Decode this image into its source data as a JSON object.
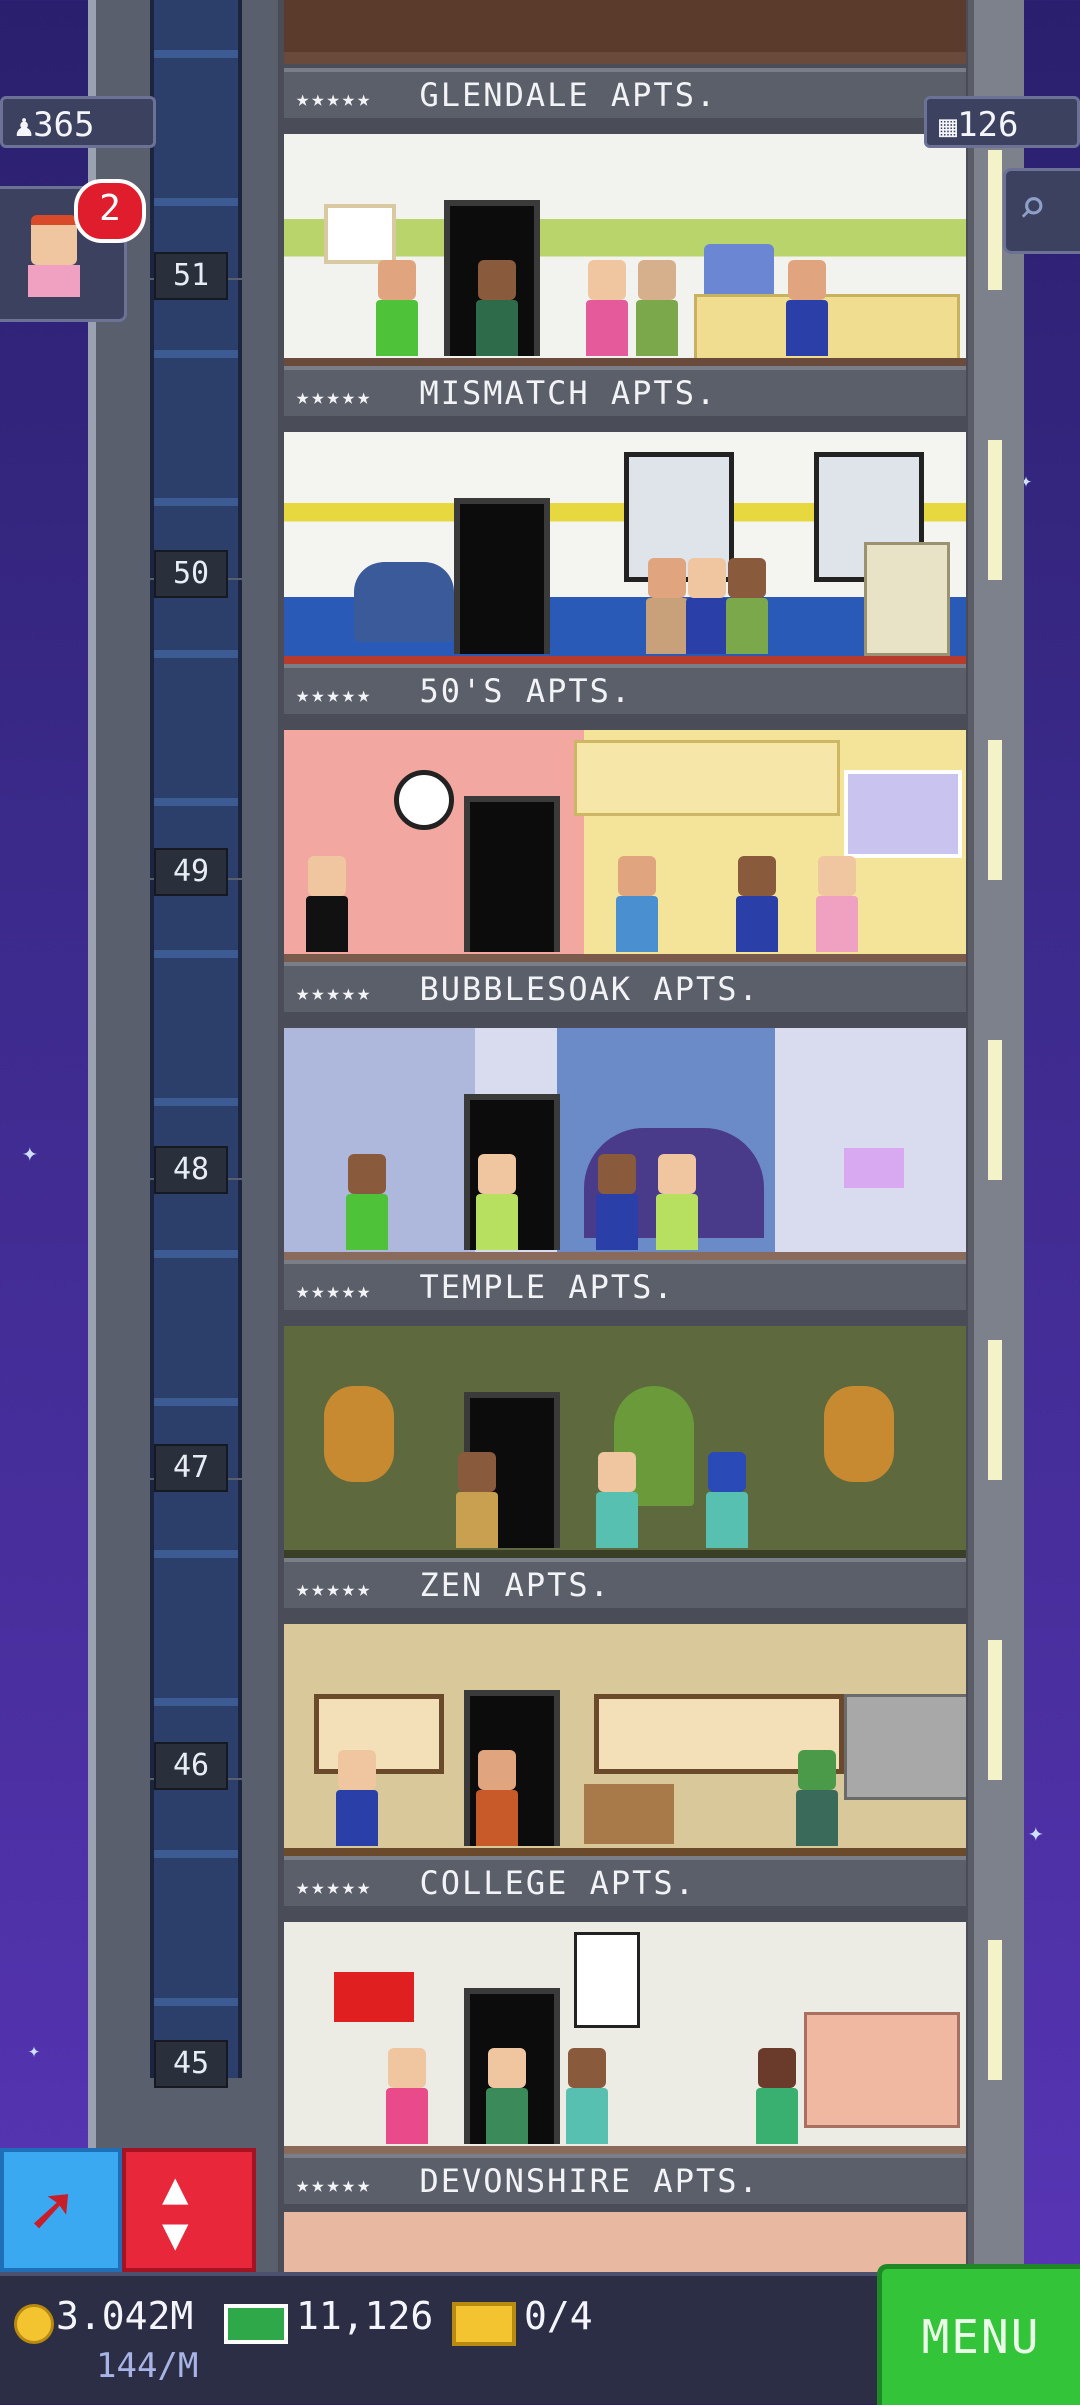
{
  "hud": {
    "population": "365",
    "floors_count": "126",
    "notification_count": "2"
  },
  "floors": [
    {
      "number": "51",
      "name": "MISMATCH APTS."
    },
    {
      "number": "50",
      "name": "50'S APTS."
    },
    {
      "number": "49",
      "name": "BUBBLESOAK APTS."
    },
    {
      "number": "48",
      "name": "TEMPLE APTS."
    },
    {
      "number": "47",
      "name": "ZEN APTS."
    },
    {
      "number": "46",
      "name": "COLLEGE APTS."
    },
    {
      "number": "45",
      "name": "DEVONSHIRE APTS."
    }
  ],
  "top_floor_label": "GLENDALE APTS.",
  "stars": "★★★★★",
  "bottom_bar": {
    "coins": "3.042M",
    "coins_rate": "144/M",
    "bux": "11,126",
    "tickets": "0/4",
    "menu_label": "MENU"
  },
  "colors": {
    "sky": "#3b2a8a",
    "menu_green": "#33c43a",
    "elevator_red": "#e8273a",
    "arrow_blue": "#3aa9f2",
    "badge_red": "#e01d2c"
  }
}
